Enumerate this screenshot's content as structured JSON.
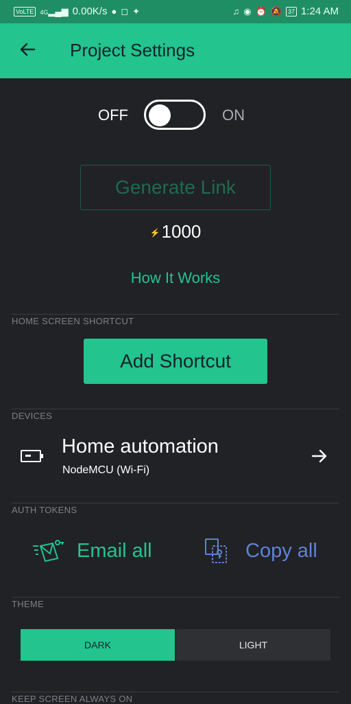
{
  "status_bar": {
    "network_chip": "VoLTE",
    "signal_label": "4G",
    "speed": "0.00K/s",
    "battery": "37",
    "time": "1:24 AM"
  },
  "header": {
    "title": "Project Settings"
  },
  "share": {
    "off_label": "OFF",
    "on_label": "ON",
    "toggle_on": false,
    "generate_label": "Generate Link",
    "energy": "1000",
    "how_it_works": "How It Works"
  },
  "sections": {
    "home_shortcut": "HOME SCREEN SHORTCUT",
    "devices": "DEVICES",
    "auth_tokens": "AUTH TOKENS",
    "theme": "THEME",
    "keep_screen": "KEEP SCREEN ALWAYS ON"
  },
  "shortcut": {
    "label": "Add Shortcut"
  },
  "device": {
    "name": "Home automation",
    "board": "NodeMCU (Wi-Fi)"
  },
  "tokens": {
    "email_label": "Email all",
    "copy_label": "Copy all"
  },
  "theme": {
    "dark_label": "DARK",
    "light_label": "LIGHT",
    "selected": "DARK"
  },
  "colors": {
    "accent": "#23c48e",
    "background": "#212225",
    "link_blue": "#5f82d9",
    "status_bar": "#1f8e64"
  },
  "icons": [
    "back-arrow-icon",
    "device-icon",
    "arrow-right-icon",
    "email-icon",
    "copy-icon",
    "facebook-icon",
    "instagram-icon",
    "twitter-icon",
    "headphones-icon",
    "eye-icon",
    "alarm-icon",
    "mute-icon",
    "battery-icon",
    "lightning-icon"
  ]
}
